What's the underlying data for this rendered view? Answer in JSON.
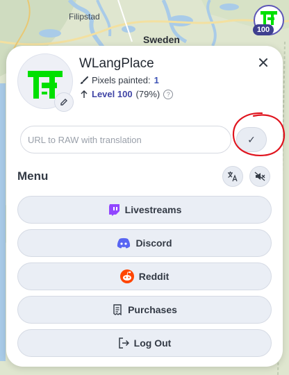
{
  "map": {
    "labels": {
      "filipstad": "Filipstad",
      "sweden": "Sweden"
    }
  },
  "user": {
    "name": "WLangPlace",
    "level_badge": "100"
  },
  "stats": {
    "pixels_label": "Pixels painted:",
    "pixels_value": "1",
    "level_label": "Level 100",
    "level_percent": "(79%)",
    "help_glyph": "?"
  },
  "translation": {
    "placeholder": "URL to RAW with translation",
    "value": "",
    "confirm_glyph": "✓"
  },
  "menu": {
    "title": "Menu",
    "items": [
      {
        "label": "Livestreams",
        "icon": "twitch-icon",
        "color": "#9146ff"
      },
      {
        "label": "Discord",
        "icon": "discord-icon",
        "color": "#5865f2"
      },
      {
        "label": "Reddit",
        "icon": "reddit-icon",
        "color": "#ff4500"
      },
      {
        "label": "Purchases",
        "icon": "receipt-icon",
        "color": "#333a45"
      },
      {
        "label": "Log Out",
        "icon": "logout-icon",
        "color": "#333a45"
      }
    ]
  },
  "colors": {
    "accent": "#4045a6",
    "logo_green": "#00e000",
    "annotation_red": "#e0141e"
  }
}
